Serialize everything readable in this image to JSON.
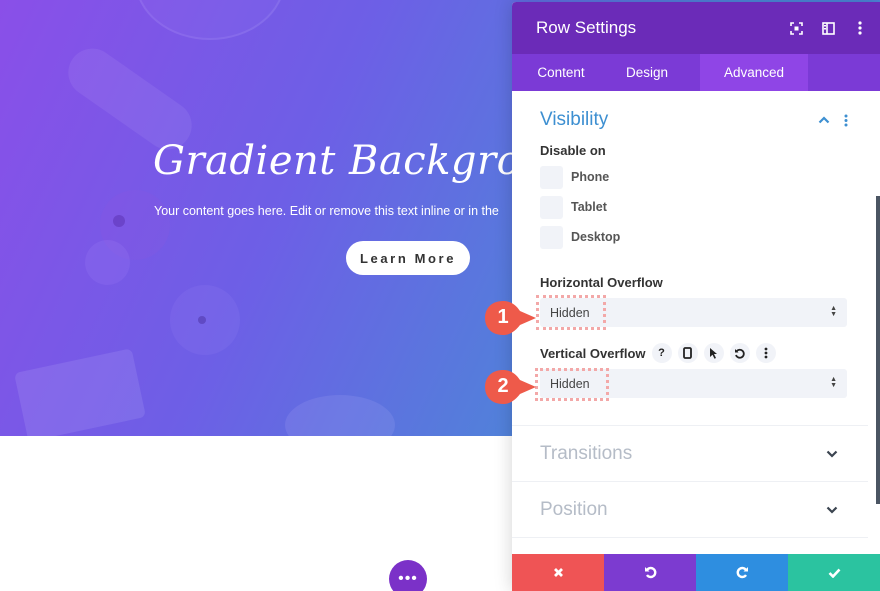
{
  "hero": {
    "title": "Gradient Background A",
    "text": "Your content goes here. Edit or remove this text inline or in the",
    "button_label": "Learn More"
  },
  "page": {
    "more_button_label": "•••"
  },
  "panel": {
    "title": "Row Settings",
    "header_icons": [
      "fullscreen-icon",
      "split-view-icon",
      "more-vertical-icon"
    ],
    "tabs": [
      {
        "label": "Content",
        "active": false
      },
      {
        "label": "Design",
        "active": false
      },
      {
        "label": "Advanced",
        "active": true
      }
    ],
    "visibility": {
      "title": "Visibility",
      "expanded": true,
      "disable_on_label": "Disable on",
      "options": [
        {
          "label": "Phone",
          "checked": false
        },
        {
          "label": "Tablet",
          "checked": false
        },
        {
          "label": "Desktop",
          "checked": false
        }
      ],
      "horizontal_overflow": {
        "label": "Horizontal Overflow",
        "value": "Hidden"
      },
      "vertical_overflow": {
        "label": "Vertical Overflow",
        "value": "Hidden",
        "tool_icons": [
          "help-icon",
          "responsive-phone-icon",
          "hover-cursor-icon",
          "reset-icon",
          "more-vertical-icon"
        ]
      }
    },
    "collapsed_sections": [
      {
        "title": "Transitions"
      },
      {
        "title": "Position"
      }
    ],
    "footer": {
      "buttons": [
        "close",
        "undo",
        "redo",
        "save"
      ],
      "colors": {
        "close": "#ef5455",
        "undo": "#7c3bd0",
        "redo": "#2e8ee0",
        "save": "#2bc3a0"
      }
    }
  },
  "callouts": [
    {
      "number": "1",
      "target": "Horizontal Overflow"
    },
    {
      "number": "2",
      "target": "Vertical Overflow"
    }
  ],
  "colors": {
    "header": "#6b2bb8",
    "tabs": "#7b3ad6",
    "tab_active": "#8f45e6",
    "section_title": "#3d8fd1",
    "callout": "#ee5a4a"
  }
}
